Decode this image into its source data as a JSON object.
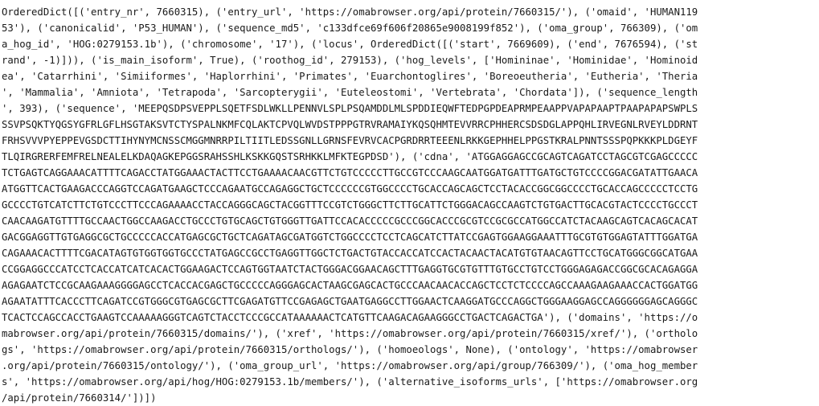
{
  "terminal": {
    "background": "#ffffff",
    "text_color": "#1a1a1a",
    "lines": [
      "OrderedDict([('entry_nr', 7660315), ('entry_url', 'https://omabrowser.org/api/protein/7660315/'), ('omaid', 'HUMAN119",
      "53'), ('canonicalid', 'P53_HUMAN'), ('sequence_md5', 'c133dfce69f606f20865e9008199f852'), ('oma_group', 766309), ('om",
      "a_hog_id', 'HOG:0279153.1b'), ('chromosome', '17'), ('locus', OrderedDict([('start', 7669609), ('end', 7676594), ('st",
      "rand', -1)])), ('is_main_isoform', True), ('roothog_id', 279153), ('hog_levels', ['Homininae', 'Hominidae', 'Hominoid",
      "ea', 'Catarrhini', 'Simiiformes', 'Haplorrhini', 'Primates', 'Euarchontoglires', 'Boreoeutheria', 'Eutheria', 'Theria",
      "', 'Mammalia', 'Amniota', 'Tetrapoda', 'Sarcopterygii', 'Euteleostomi', 'Vertebrata', 'Chordata']), ('sequence_length",
      "', 393), ('sequence', 'MEEPQSDPSVEPPLSQETFSDLWKLLPENNVLSPLPSQAMDDLMLSPDDIEQWFTEDPGPDEAPRMPEAAPPVAPAPAAPTPAAPAPAPSWPLS",
      "SSVPSQKTYQGSYGFRLGFLHSGTAKSVTCTYSPALNKMFCQLAKTCPVQLWVDSTPPPGTRVRAMAIYKQSQHMTEVVRRCPHHERCSDSDGLAPPQHLIRVEGNLRVEYLDDRNT",
      "FRHSVVVPYEPPEVGSDCTTIHYNYMCNSSCMGGMNRRPILTIITLEDSSGNLLGRNSFEVRVCACPGRDRRTEEENLRKKGEPHHELPPGSTKRALPNNTSSSPQPKKKPLDGEYF",
      "TLQIRGRERFEMFRELNEALELKDAQAGKEPGGSRAHSSHLKSKKGQSTSRHKKLMFKTEGPDSD'), ('cdna', 'ATGGAGGAGCCGCAGTCAGATCCTAGCGTCGAGCCCCC",
      "TCTGAGTCAGGAAACATTTTCAGACCTATGGAAACTACTTCCTGAAAACAACGTTCTGTCCCCCTTGCCGTCCCAAGCAATGGATGATTTGATGCTGTCCCCGGACGATATTGAACA",
      "ATGGTTCACTGAAGACCCAGGTCCAGATGAAGCTCCCAGAATGCCAGAGGCTGCTCCCCCCGTGGCCCCTGCACCAGCAGCTCCTACACCGGCGGCCCCTGCACCAGCCCCCTCCTG",
      "GCCCCTGTCATCTTCTGTCCCTTCCCAGAAAACCTACCAGGGCAGCTACGGTTTCCGTCTGGGCTTCTTGCATTCTGGGACAGCCAAGTCTGTGACTTGCACGTACTCCCCTGCCCT",
      "CAACAAGATGTTTTGCCAACTGGCCAAGACCTGCCCTGTGCAGCTGTGGGTTGATTCCACACCCCCGCCCGGCACCCGCGTCCGCGCCATGGCCATCTACAAGCAGTCACAGCACAT",
      "GACGGAGGTTGTGAGGCGCTGCCCCCACCATGAGCGCTGCTCAGATAGCGATGGTCTGGCCCCTCCTCAGCATCTTATCCGAGTGGAAGGAAATTTGCGTGTGGAGTATTTGGATGA",
      "CAGAAACACTTTTCGACATAGTGTGGTGGTGCCCTATGAGCCGCCTGAGGTTGGCTCTGACTGTACCACCATCCACTACAACTACATGTGTAACAGTTCCTGCATGGGCGGCATGAA",
      "CCGGAGGCCCATCCTCACCATCATCACACTGGAAGACTCCAGTGGTAATCTACTGGGACGGAACAGCTTTGAGGTGCGTGTTTGTGCCTGTCCTGGGAGAGACCGGCGCACAGAGGA",
      "AGAGAATCTCCGCAAGAAAGGGGAGCCTCACCACGAGCTGCCCCCAGGGAGCACTAAGCGAGCACTGCCCAACAACACCAGCTCCTCTCCCCAGCCAAAGAAGAAACCACTGGATGG",
      "AGAATATTTCACCCTTCAGATCCGTGGGCGTGAGCGCTTCGAGATGTTCCGAGAGCTGAATGAGGCCTTGGAACTCAAGGATGCCCAGGCTGGGAAGGAGCCAGGGGGGAGCAGGGC",
      "TCACTCCAGCCACCTGAAGTCCAAAAAGGGTCAGTCTACCTCCCGCCATAAAAAACTCATGTTCAAGACAGAAGGGCCTGACTCAGACTGA'), ('domains', 'https://o",
      "mabrowser.org/api/protein/7660315/domains/'), ('xref', 'https://omabrowser.org/api/protein/7660315/xref/'), ('ortholo",
      "gs', 'https://omabrowser.org/api/protein/7660315/orthologs/'), ('homoeologs', None), ('ontology', 'https://omabrowser",
      ".org/api/protein/7660315/ontology/'), ('oma_group_url', 'https://omabrowser.org/api/group/766309/'), ('oma_hog_member",
      "s', 'https://omabrowser.org/api/hog/HOG:0279153.1b/members/'), ('alternative_isoforms_urls', ['https://omabrowser.org",
      "/api/protein/7660314/'])])"
    ]
  }
}
